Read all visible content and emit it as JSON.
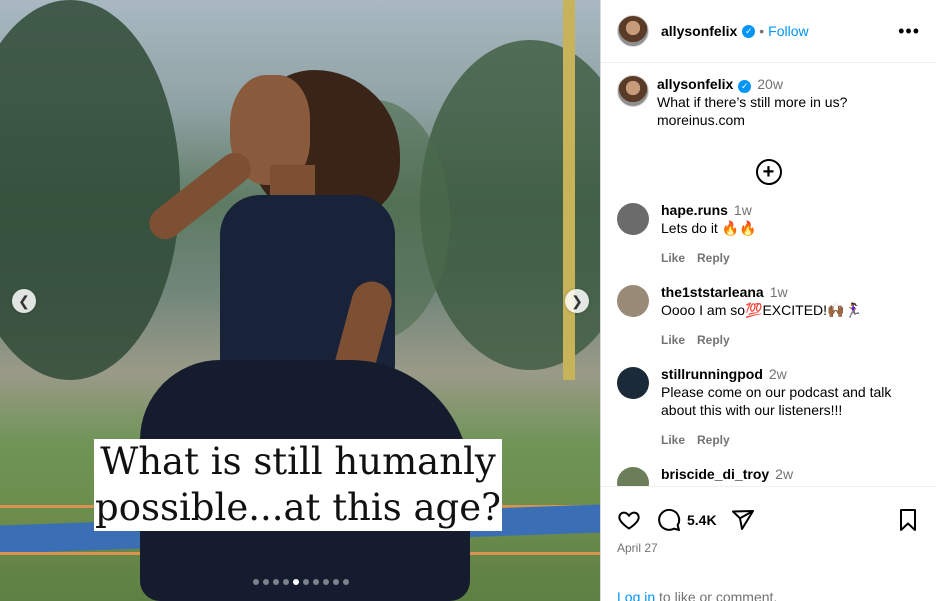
{
  "post": {
    "username": "allysonfelix",
    "verified_icon": "verified-badge-icon",
    "separator": "•",
    "follow_label": "Follow",
    "more_icon": "more-options-icon"
  },
  "media": {
    "overlay_text": "What is still humanly possible...at this age?",
    "carousel_total": 10,
    "carousel_active_index": 4,
    "prev_icon": "chevron-left-icon",
    "next_icon": "chevron-right-icon"
  },
  "caption": {
    "username": "allysonfelix",
    "time": "20w",
    "line1": "What if there’s still more in us?",
    "line2": "moreinus.com"
  },
  "comments": [
    {
      "username": "hape.runs",
      "time": "1w",
      "text": "Lets do it 🔥🔥",
      "like": "Like",
      "reply": "Reply",
      "avatar_color": "#6b6b6b"
    },
    {
      "username": "the1ststarleana",
      "time": "1w",
      "text": "Oooo I am so💯EXCITED!🙌🏾🏃🏾‍♀",
      "like": "Like",
      "reply": "Reply",
      "avatar_color": "#9a8a78"
    },
    {
      "username": "stillrunningpod",
      "time": "2w",
      "text": "Please come on our podcast and talk about this with our listeners!!!",
      "like": "Like",
      "reply": "Reply",
      "avatar_color": "#1b2a38"
    },
    {
      "username": "briscide_di_troy",
      "time": "2w",
      "text": "",
      "like": "",
      "reply": "",
      "avatar_color": "#6c7d5a"
    }
  ],
  "actions": {
    "like_icon": "heart-icon",
    "comment_icon": "comment-icon",
    "comment_count": "5.4K",
    "share_icon": "share-icon",
    "save_icon": "bookmark-icon",
    "date": "April 27",
    "login_link": "Log in",
    "login_rest": " to like or comment."
  },
  "colors": {
    "link": "#0095f6",
    "muted": "#737373",
    "border": "#dbdbdb"
  }
}
